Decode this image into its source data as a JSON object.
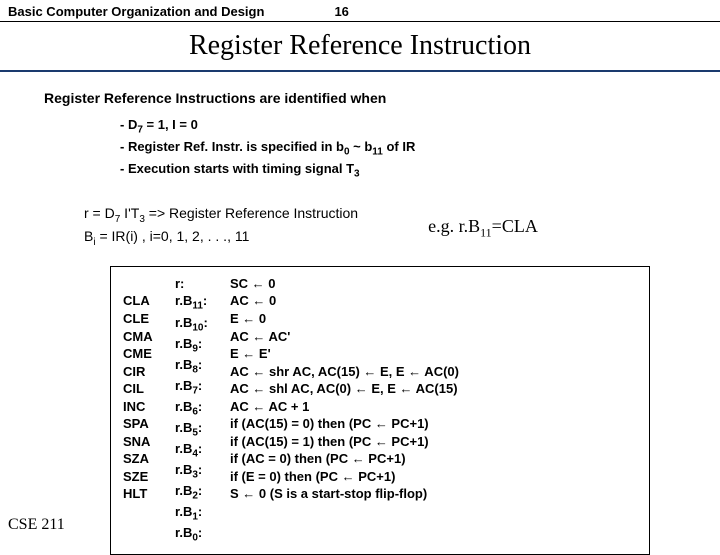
{
  "header": {
    "section": "Basic Computer Organization and Design",
    "page": "16"
  },
  "title": "Register Reference Instruction",
  "subtitle": "Register Reference Instructions are identified when",
  "bullets": {
    "b1_pre": "- D",
    "b1_sub": "7",
    "b1_post": " = 1, I = 0",
    "b2_pre": "- Register Ref. Instr. is specified in b",
    "b2_sub1": "0",
    "b2_mid": " ~ b",
    "b2_sub2": "11",
    "b2_post": " of IR",
    "b3_pre": "- Execution starts with timing signal T",
    "b3_sub": "3"
  },
  "defs": {
    "l1_pre": "r = D",
    "l1_sub1": "7",
    "l1_mid": " I'T",
    "l1_sub2": "3",
    "l1_post": "  => Register Reference Instruction",
    "l2_pre": "B",
    "l2_sub": "i",
    "l2_post": " = IR(i) , i=0, 1, 2, . . ., 11",
    "example_pre": "e.g. r.B",
    "example_sub": "11",
    "example_post": "=CLA"
  },
  "table": {
    "r_label": "r:",
    "mnemonics": [
      "CLA",
      "CLE",
      "CMA",
      "CME",
      "CIR",
      "CIL",
      "INC",
      "SPA",
      "SNA",
      "SZA",
      "SZE",
      "HLT"
    ],
    "conds": [
      "r.B",
      "r.B",
      "r.B",
      "r.B",
      "r.B",
      "r.B",
      "r.B",
      "r.B",
      "r.B",
      "r.B",
      "r.B",
      "r.B"
    ],
    "cond_subs": [
      "11",
      "10",
      "9",
      "8",
      "7",
      "6",
      "5",
      "4",
      "3",
      "2",
      "1",
      "0"
    ],
    "actions": {
      "a_r": "SC ← 0",
      "a0": "AC ← 0",
      "a1": "E ← 0",
      "a2": "AC ← AC'",
      "a3": "E ← E'",
      "a4": "AC ← shr AC, AC(15) ← E, E ← AC(0)",
      "a5": "AC ← shl AC, AC(0) ← E, E ← AC(15)",
      "a6": "AC ← AC + 1",
      "a7": "if (AC(15) = 0) then (PC ← PC+1)",
      "a8": "if (AC(15) = 1) then (PC ← PC+1)",
      "a9": "if (AC = 0) then (PC ← PC+1)",
      "a10": "if (E = 0) then (PC ← PC+1)",
      "a11": "S ← 0  (S is a start-stop flip-flop)"
    }
  },
  "footer": "CSE 211"
}
